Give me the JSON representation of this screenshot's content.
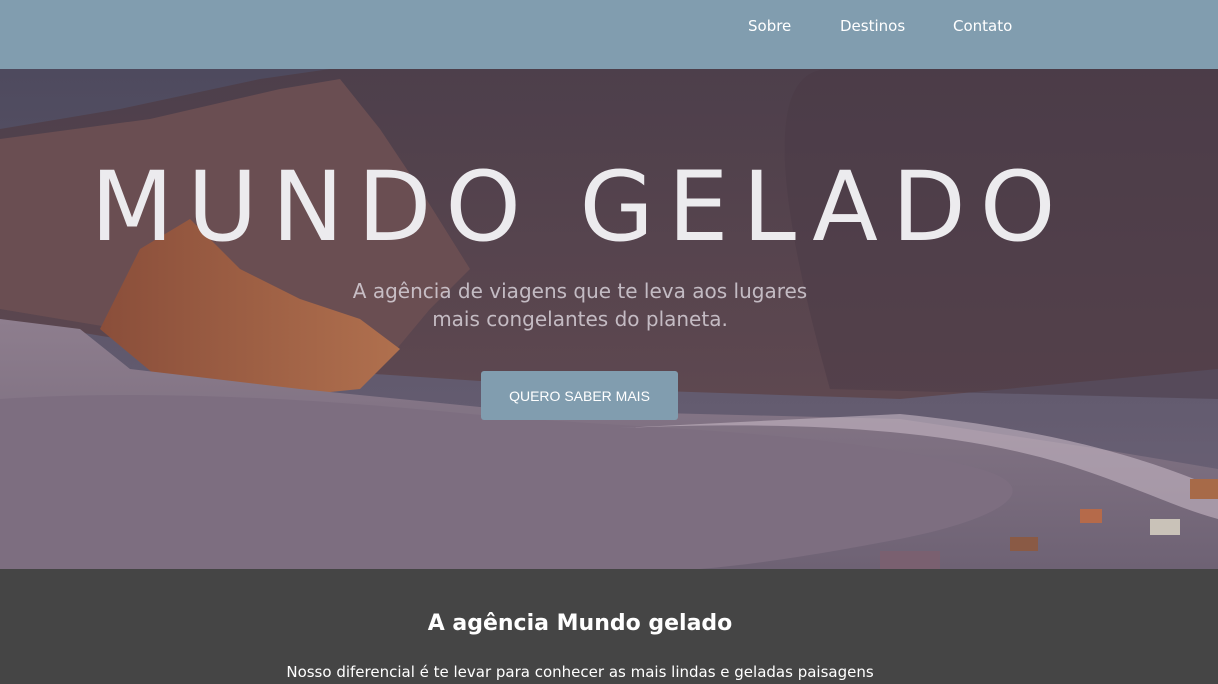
{
  "nav": {
    "items": [
      {
        "label": "Sobre"
      },
      {
        "label": "Destinos"
      },
      {
        "label": "Contato"
      }
    ]
  },
  "hero": {
    "title": "MUNDO GELADO",
    "subtitle": "A agência de viagens que te leva aos lugares mais congelantes do planeta.",
    "cta_label": "QUERO SABER MAIS"
  },
  "about": {
    "title": "A agência Mundo gelado",
    "text": "Nosso diferencial é te levar para conhecer as mais lindas e geladas paisagens"
  },
  "colors": {
    "navbar": "#819daf",
    "cta": "#819daf",
    "about_bg": "#454545"
  }
}
